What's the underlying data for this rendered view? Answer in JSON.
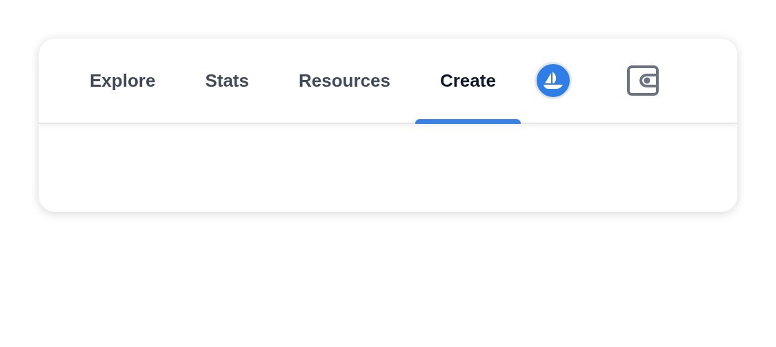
{
  "nav": {
    "tabs": [
      {
        "label": "Explore",
        "selected": false
      },
      {
        "label": "Stats",
        "selected": false
      },
      {
        "label": "Resources",
        "selected": false
      },
      {
        "label": "Create",
        "selected": true
      }
    ]
  }
}
